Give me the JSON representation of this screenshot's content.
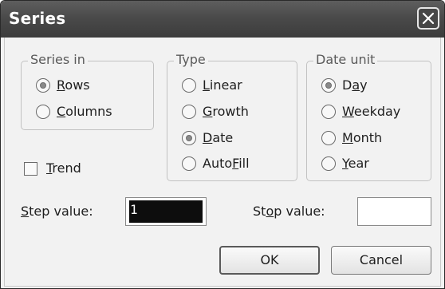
{
  "window": {
    "title": "Series"
  },
  "series_in": {
    "legend": "Series in",
    "options": [
      {
        "label": "Rows",
        "mnemonic": "R",
        "selected": true
      },
      {
        "label": "Columns",
        "mnemonic": "C",
        "selected": false
      }
    ]
  },
  "type": {
    "legend": "Type",
    "options": [
      {
        "label": "Linear",
        "mnemonic": "L",
        "selected": false
      },
      {
        "label": "Growth",
        "mnemonic": "G",
        "selected": false
      },
      {
        "label": "Date",
        "mnemonic": "D",
        "selected": true
      },
      {
        "label": "AutoFill",
        "mnemonic": "F",
        "selected": false
      }
    ]
  },
  "date_unit": {
    "legend": "Date unit",
    "options": [
      {
        "label": "Day",
        "mnemonic": "a",
        "selected": true
      },
      {
        "label": "Weekday",
        "mnemonic": "W",
        "selected": false
      },
      {
        "label": "Month",
        "mnemonic": "M",
        "selected": false
      },
      {
        "label": "Year",
        "mnemonic": "Y",
        "selected": false
      }
    ]
  },
  "trend": {
    "label": "Trend",
    "mnemonic": "T",
    "checked": false
  },
  "step": {
    "label": "Step value:",
    "mnemonic": "S",
    "value": "1"
  },
  "stop": {
    "label": "Stop value:",
    "mnemonic": "o",
    "value": ""
  },
  "buttons": {
    "ok": "OK",
    "cancel": "Cancel"
  }
}
